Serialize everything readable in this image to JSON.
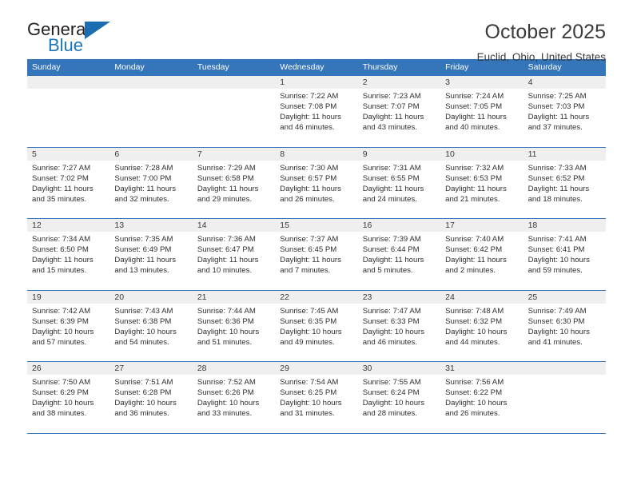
{
  "logo": {
    "name_top": "General",
    "name_bottom": "Blue",
    "triangle_icon": "blue-triangle-icon",
    "brand_color": "#1b75bb"
  },
  "header": {
    "month_title": "October 2025",
    "location": "Euclid, Ohio, United States"
  },
  "colors": {
    "header_blue": "#3576bb",
    "date_band": "#efefef",
    "text": "#2f2f2f"
  },
  "weekdays": [
    "Sunday",
    "Monday",
    "Tuesday",
    "Wednesday",
    "Thursday",
    "Friday",
    "Saturday"
  ],
  "calendar_data": {
    "type": "table",
    "title": "October 2025",
    "location": "Euclid, Ohio, United States",
    "weeks": [
      [
        {
          "day": ""
        },
        {
          "day": ""
        },
        {
          "day": ""
        },
        {
          "day": "1",
          "sunrise": "Sunrise: 7:22 AM",
          "sunset": "Sunset: 7:08 PM",
          "daylight_line1": "Daylight: 11 hours",
          "daylight_line2": "and 46 minutes."
        },
        {
          "day": "2",
          "sunrise": "Sunrise: 7:23 AM",
          "sunset": "Sunset: 7:07 PM",
          "daylight_line1": "Daylight: 11 hours",
          "daylight_line2": "and 43 minutes."
        },
        {
          "day": "3",
          "sunrise": "Sunrise: 7:24 AM",
          "sunset": "Sunset: 7:05 PM",
          "daylight_line1": "Daylight: 11 hours",
          "daylight_line2": "and 40 minutes."
        },
        {
          "day": "4",
          "sunrise": "Sunrise: 7:25 AM",
          "sunset": "Sunset: 7:03 PM",
          "daylight_line1": "Daylight: 11 hours",
          "daylight_line2": "and 37 minutes."
        }
      ],
      [
        {
          "day": "5",
          "sunrise": "Sunrise: 7:27 AM",
          "sunset": "Sunset: 7:02 PM",
          "daylight_line1": "Daylight: 11 hours",
          "daylight_line2": "and 35 minutes."
        },
        {
          "day": "6",
          "sunrise": "Sunrise: 7:28 AM",
          "sunset": "Sunset: 7:00 PM",
          "daylight_line1": "Daylight: 11 hours",
          "daylight_line2": "and 32 minutes."
        },
        {
          "day": "7",
          "sunrise": "Sunrise: 7:29 AM",
          "sunset": "Sunset: 6:58 PM",
          "daylight_line1": "Daylight: 11 hours",
          "daylight_line2": "and 29 minutes."
        },
        {
          "day": "8",
          "sunrise": "Sunrise: 7:30 AM",
          "sunset": "Sunset: 6:57 PM",
          "daylight_line1": "Daylight: 11 hours",
          "daylight_line2": "and 26 minutes."
        },
        {
          "day": "9",
          "sunrise": "Sunrise: 7:31 AM",
          "sunset": "Sunset: 6:55 PM",
          "daylight_line1": "Daylight: 11 hours",
          "daylight_line2": "and 24 minutes."
        },
        {
          "day": "10",
          "sunrise": "Sunrise: 7:32 AM",
          "sunset": "Sunset: 6:53 PM",
          "daylight_line1": "Daylight: 11 hours",
          "daylight_line2": "and 21 minutes."
        },
        {
          "day": "11",
          "sunrise": "Sunrise: 7:33 AM",
          "sunset": "Sunset: 6:52 PM",
          "daylight_line1": "Daylight: 11 hours",
          "daylight_line2": "and 18 minutes."
        }
      ],
      [
        {
          "day": "12",
          "sunrise": "Sunrise: 7:34 AM",
          "sunset": "Sunset: 6:50 PM",
          "daylight_line1": "Daylight: 11 hours",
          "daylight_line2": "and 15 minutes."
        },
        {
          "day": "13",
          "sunrise": "Sunrise: 7:35 AM",
          "sunset": "Sunset: 6:49 PM",
          "daylight_line1": "Daylight: 11 hours",
          "daylight_line2": "and 13 minutes."
        },
        {
          "day": "14",
          "sunrise": "Sunrise: 7:36 AM",
          "sunset": "Sunset: 6:47 PM",
          "daylight_line1": "Daylight: 11 hours",
          "daylight_line2": "and 10 minutes."
        },
        {
          "day": "15",
          "sunrise": "Sunrise: 7:37 AM",
          "sunset": "Sunset: 6:45 PM",
          "daylight_line1": "Daylight: 11 hours",
          "daylight_line2": "and 7 minutes."
        },
        {
          "day": "16",
          "sunrise": "Sunrise: 7:39 AM",
          "sunset": "Sunset: 6:44 PM",
          "daylight_line1": "Daylight: 11 hours",
          "daylight_line2": "and 5 minutes."
        },
        {
          "day": "17",
          "sunrise": "Sunrise: 7:40 AM",
          "sunset": "Sunset: 6:42 PM",
          "daylight_line1": "Daylight: 11 hours",
          "daylight_line2": "and 2 minutes."
        },
        {
          "day": "18",
          "sunrise": "Sunrise: 7:41 AM",
          "sunset": "Sunset: 6:41 PM",
          "daylight_line1": "Daylight: 10 hours",
          "daylight_line2": "and 59 minutes."
        }
      ],
      [
        {
          "day": "19",
          "sunrise": "Sunrise: 7:42 AM",
          "sunset": "Sunset: 6:39 PM",
          "daylight_line1": "Daylight: 10 hours",
          "daylight_line2": "and 57 minutes."
        },
        {
          "day": "20",
          "sunrise": "Sunrise: 7:43 AM",
          "sunset": "Sunset: 6:38 PM",
          "daylight_line1": "Daylight: 10 hours",
          "daylight_line2": "and 54 minutes."
        },
        {
          "day": "21",
          "sunrise": "Sunrise: 7:44 AM",
          "sunset": "Sunset: 6:36 PM",
          "daylight_line1": "Daylight: 10 hours",
          "daylight_line2": "and 51 minutes."
        },
        {
          "day": "22",
          "sunrise": "Sunrise: 7:45 AM",
          "sunset": "Sunset: 6:35 PM",
          "daylight_line1": "Daylight: 10 hours",
          "daylight_line2": "and 49 minutes."
        },
        {
          "day": "23",
          "sunrise": "Sunrise: 7:47 AM",
          "sunset": "Sunset: 6:33 PM",
          "daylight_line1": "Daylight: 10 hours",
          "daylight_line2": "and 46 minutes."
        },
        {
          "day": "24",
          "sunrise": "Sunrise: 7:48 AM",
          "sunset": "Sunset: 6:32 PM",
          "daylight_line1": "Daylight: 10 hours",
          "daylight_line2": "and 44 minutes."
        },
        {
          "day": "25",
          "sunrise": "Sunrise: 7:49 AM",
          "sunset": "Sunset: 6:30 PM",
          "daylight_line1": "Daylight: 10 hours",
          "daylight_line2": "and 41 minutes."
        }
      ],
      [
        {
          "day": "26",
          "sunrise": "Sunrise: 7:50 AM",
          "sunset": "Sunset: 6:29 PM",
          "daylight_line1": "Daylight: 10 hours",
          "daylight_line2": "and 38 minutes."
        },
        {
          "day": "27",
          "sunrise": "Sunrise: 7:51 AM",
          "sunset": "Sunset: 6:28 PM",
          "daylight_line1": "Daylight: 10 hours",
          "daylight_line2": "and 36 minutes."
        },
        {
          "day": "28",
          "sunrise": "Sunrise: 7:52 AM",
          "sunset": "Sunset: 6:26 PM",
          "daylight_line1": "Daylight: 10 hours",
          "daylight_line2": "and 33 minutes."
        },
        {
          "day": "29",
          "sunrise": "Sunrise: 7:54 AM",
          "sunset": "Sunset: 6:25 PM",
          "daylight_line1": "Daylight: 10 hours",
          "daylight_line2": "and 31 minutes."
        },
        {
          "day": "30",
          "sunrise": "Sunrise: 7:55 AM",
          "sunset": "Sunset: 6:24 PM",
          "daylight_line1": "Daylight: 10 hours",
          "daylight_line2": "and 28 minutes."
        },
        {
          "day": "31",
          "sunrise": "Sunrise: 7:56 AM",
          "sunset": "Sunset: 6:22 PM",
          "daylight_line1": "Daylight: 10 hours",
          "daylight_line2": "and 26 minutes."
        },
        {
          "day": ""
        }
      ]
    ]
  }
}
